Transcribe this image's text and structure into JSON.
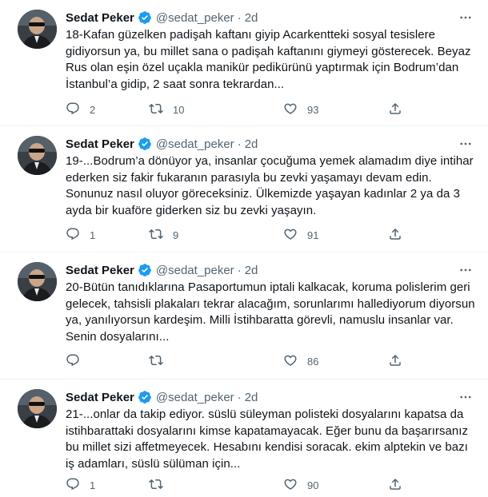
{
  "tweets": [
    {
      "name": "Sedat Peker",
      "handle": "@sedat_peker",
      "time": "2d",
      "text": "18-Kafan güzelken padişah kaftanı giyip Acarkentteki sosyal tesislere gidiyorsun ya, bu millet sana o padişah kaftanını giymeyi gösterecek. Beyaz Rus olan eşin özel uçakla manikür pedikürünü yaptırmak için Bodrum’dan İstanbul’a gidip, 2 saat sonra tekrardan...",
      "replies": "2",
      "retweets": "10",
      "likes": "93"
    },
    {
      "name": "Sedat Peker",
      "handle": "@sedat_peker",
      "time": "2d",
      "text": "19-...Bodrum’a dönüyor ya, insanlar çocuğuma yemek alamadım diye intihar ederken siz fakir fukaranın parasıyla bu zevki yaşamayı devam edin. Sonunuz nasıl oluyor göreceksiniz. Ülkemizde yaşayan kadınlar 2 ya da 3 ayda bir kuaföre giderken siz bu zevki yaşayın.",
      "replies": "1",
      "retweets": "9",
      "likes": "91"
    },
    {
      "name": "Sedat Peker",
      "handle": "@sedat_peker",
      "time": "2d",
      "text": "20-Bütün tanıdıklarına Pasaportumun iptali kalkacak, koruma polislerim geri gelecek, tahsisli plakaları tekrar alacağım, sorunlarımı hallediyorum diyorsun ya, yanılıyorsun kardeşim. Milli İstihbaratta görevli, namuslu insanlar var. Senin dosyalarını...",
      "replies": "",
      "retweets": "",
      "likes": "86"
    },
    {
      "name": "Sedat Peker",
      "handle": "@sedat_peker",
      "time": "2d",
      "text": "21-...onlar da takip ediyor. süslü süleyman polisteki dosyalarını kapatsa da istihbarattaki dosyalarını kimse kapatamayacak. Eğer bunu da başarırsanız bu millet sizi affetmeyecek. Hesabını kendisi soracak. ekim alptekin ve bazı iş adamları, süslü sülüman için...",
      "replies": "1",
      "retweets": "",
      "likes": "90"
    }
  ],
  "colors": {
    "text": "#0f1419",
    "secondary": "#536471",
    "verified": "#1d9bf0",
    "divider": "#eff3f4"
  },
  "icons": [
    "verified-badge-icon",
    "more-icon",
    "reply-icon",
    "retweet-icon",
    "like-icon",
    "share-icon"
  ]
}
